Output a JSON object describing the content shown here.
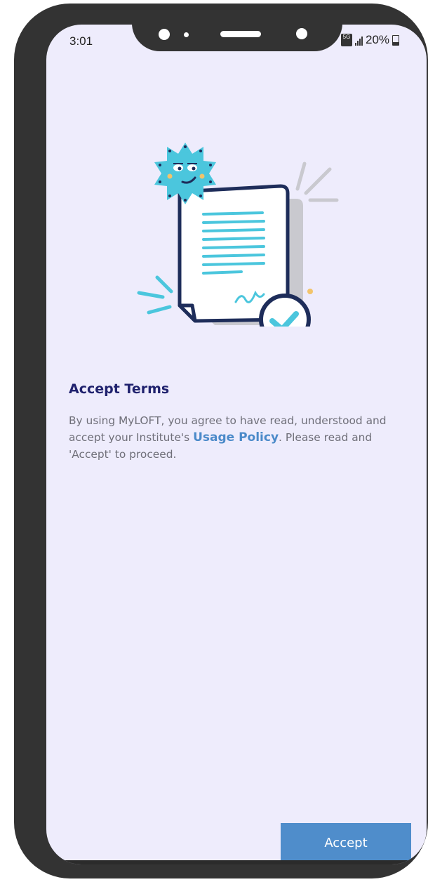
{
  "status_bar": {
    "time": "3:01",
    "network_label": "5G",
    "battery_text": "20%"
  },
  "content": {
    "title": "Accept Terms",
    "body_part1": "By using MyLOFT, you agree to have read, understood and accept your Institute's ",
    "link_text": "Usage Policy",
    "body_part2": ". Please read and 'Accept' to proceed."
  },
  "actions": {
    "accept_label": "Accept"
  },
  "icons": {
    "illustration": "terms-document-illustration-icon",
    "network": "5g-network-icon",
    "signal": "signal-bars-icon",
    "battery": "battery-icon"
  },
  "colors": {
    "background": "#eeecfc",
    "title": "#20226e",
    "link": "#4b8ac9",
    "button": "#4f8dcb",
    "frame": "#333333"
  }
}
